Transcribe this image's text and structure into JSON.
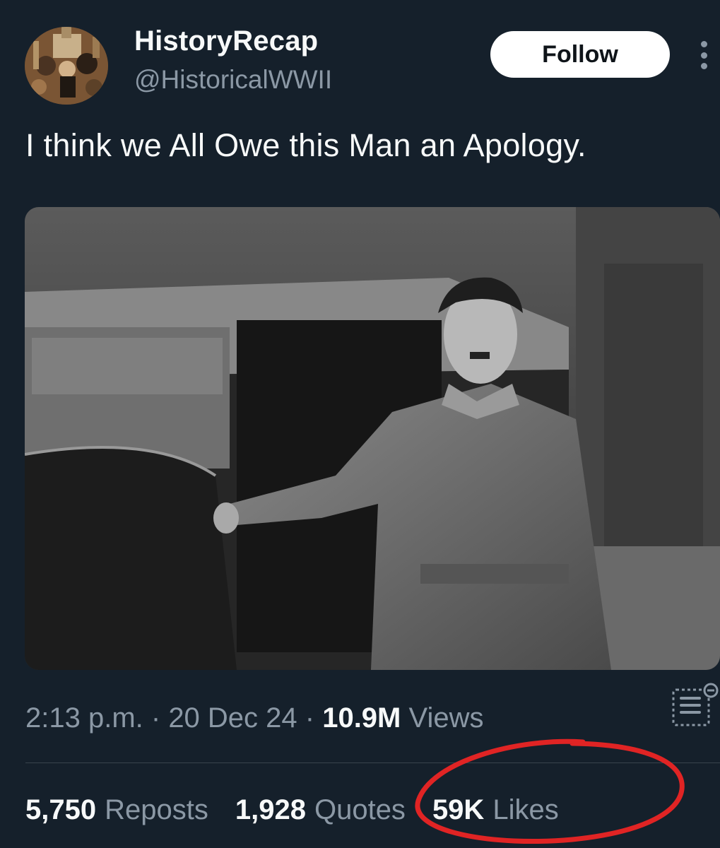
{
  "author": {
    "display_name": "HistoryRecap",
    "handle": "@HistoricalWWII",
    "avatar_icon": "history-collage-avatar"
  },
  "follow_label": "Follow",
  "tweet": {
    "text": "I think we All Owe this Man an Apology."
  },
  "media": {
    "description_icon": "historical-photo"
  },
  "meta": {
    "time": "2:13 p.m.",
    "sep1": " · ",
    "date": "20 Dec 24",
    "sep2": " · ",
    "views_count": "10.9M",
    "views_label": " Views"
  },
  "stats": [
    {
      "count": "5,750",
      "label": "Reposts"
    },
    {
      "count": "1,928",
      "label": "Quotes"
    },
    {
      "count": "59K",
      "label": "Likes"
    }
  ],
  "colors": {
    "background": "#15202b",
    "text_primary": "#f7f9f9",
    "text_secondary": "#8b98a5",
    "annotation_red": "#e02424"
  }
}
